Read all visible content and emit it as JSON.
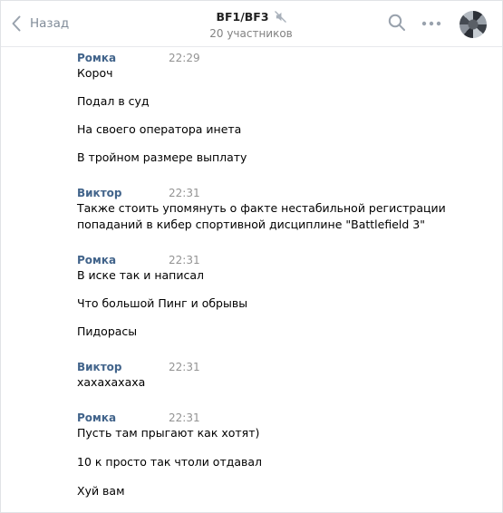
{
  "header": {
    "back_label": "Назад",
    "chat_title": "BF1/BF3",
    "participants": "20 участников",
    "icons": [
      "chevron-left-icon",
      "mute-icon",
      "search-icon",
      "more-icon",
      "avatar"
    ]
  },
  "messages": [
    {
      "author": "Ромка",
      "time": "22:29",
      "lines": [
        "Короч",
        "Подал в суд",
        "На своего оператора инета",
        "В тройном размере выплату"
      ]
    },
    {
      "author": "Виктор",
      "time": "22:31",
      "lines": [
        "Также стоить упомянуть о факте нестабильной регистрации",
        "попаданий в кибер спортивной дисциплине \"Battlefield 3\""
      ]
    },
    {
      "author": "Ромка",
      "time": "22:31",
      "lines": [
        "В иске так и написал",
        "Что большой Пинг и обрывы",
        "Пидорасы"
      ]
    },
    {
      "author": "Виктор",
      "time": "22:31",
      "lines": [
        "хахахахаха"
      ]
    },
    {
      "author": "Ромка",
      "time": "22:31",
      "lines": [
        "Пусть там прыгают как хотят)",
        "10 к просто так чтоли отдавал",
        "Хуй вам"
      ]
    }
  ]
}
